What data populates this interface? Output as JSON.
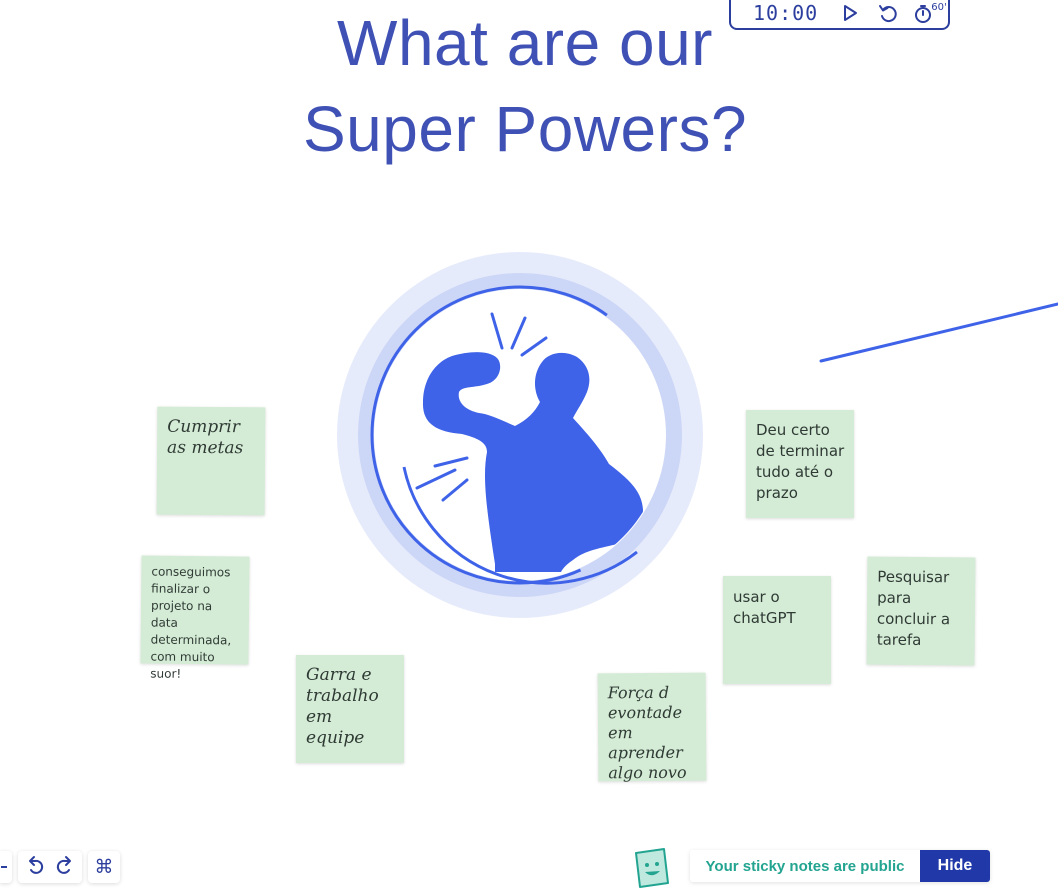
{
  "title": {
    "line1": "What are our",
    "line2": "Super Powers?"
  },
  "timer": {
    "time": "10:00",
    "play_icon": "play-icon",
    "reset_icon": "reset-icon",
    "add_icon": "add-time-60-icon",
    "add_label": "60'"
  },
  "stickies": [
    {
      "text": "Cumprir as metas"
    },
    {
      "text": "conseguimos finalizar o projeto na data determinada, com muito suor!"
    },
    {
      "text": "Garra e trabalho em equipe"
    },
    {
      "text": "Força d evontade em aprender algo novo"
    },
    {
      "text": "Deu certo de terminar tudo até o prazo"
    },
    {
      "text": "usar o chatGPT"
    },
    {
      "text": "Pesquisar para concluir a tarefa"
    }
  ],
  "toolbar": {
    "undo_icon": "undo-icon",
    "redo_icon": "redo-icon",
    "shortcuts_icon": "command-icon"
  },
  "public_bar": {
    "message": "Your sticky notes are public",
    "hide_label": "Hide",
    "mascot_icon": "sticky-mascot-icon"
  },
  "colors": {
    "title": "#3f51b5",
    "accent_blue": "#3f63e8",
    "sticky_green": "#d4ecd5",
    "public_text": "#23a491",
    "hide_button": "#2139a8"
  }
}
